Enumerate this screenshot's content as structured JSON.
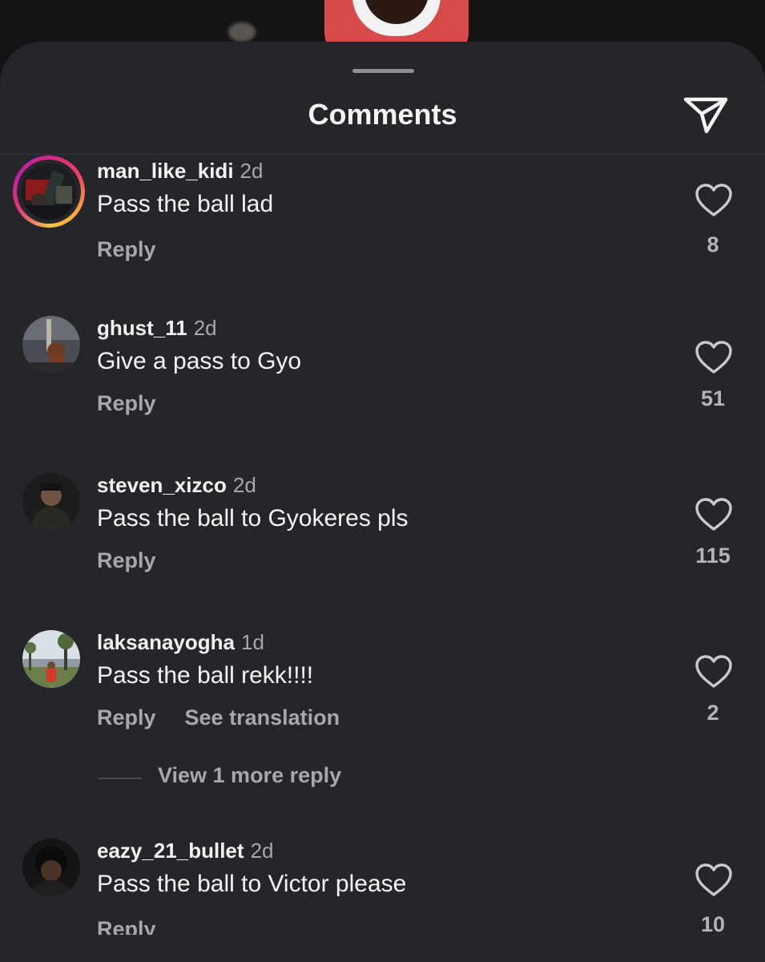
{
  "sheet": {
    "title": "Comments",
    "share_icon": "paper-plane-icon"
  },
  "comments": [
    {
      "username": "man_like_kidi",
      "age": "2d",
      "text": "Pass the ball lad",
      "reply_label": "Reply",
      "likes": "8",
      "has_story": true
    },
    {
      "username": "ghust_11",
      "age": "2d",
      "text": "Give a pass to Gyo",
      "reply_label": "Reply",
      "likes": "51",
      "has_story": false
    },
    {
      "username": "steven_xizco",
      "age": "2d",
      "text": "Pass the ball to Gyokeres pls",
      "reply_label": "Reply",
      "likes": "115",
      "has_story": false
    },
    {
      "username": "laksanayogha",
      "age": "1d",
      "text": "Pass the ball rekk!!!!",
      "reply_label": "Reply",
      "translation_label": "See translation",
      "likes": "2",
      "has_story": false,
      "view_replies_label": "View 1 more reply"
    },
    {
      "username": "eazy_21_bullet",
      "age": "2d",
      "text": "Pass the ball to Victor please",
      "reply_label": "Reply",
      "likes": "10",
      "has_story": false
    }
  ],
  "colors": {
    "sheet_background": "#25262a",
    "primary_text": "#f5f5f5",
    "secondary_text": "#a7a8ad",
    "story_ring": "#f23e64"
  }
}
